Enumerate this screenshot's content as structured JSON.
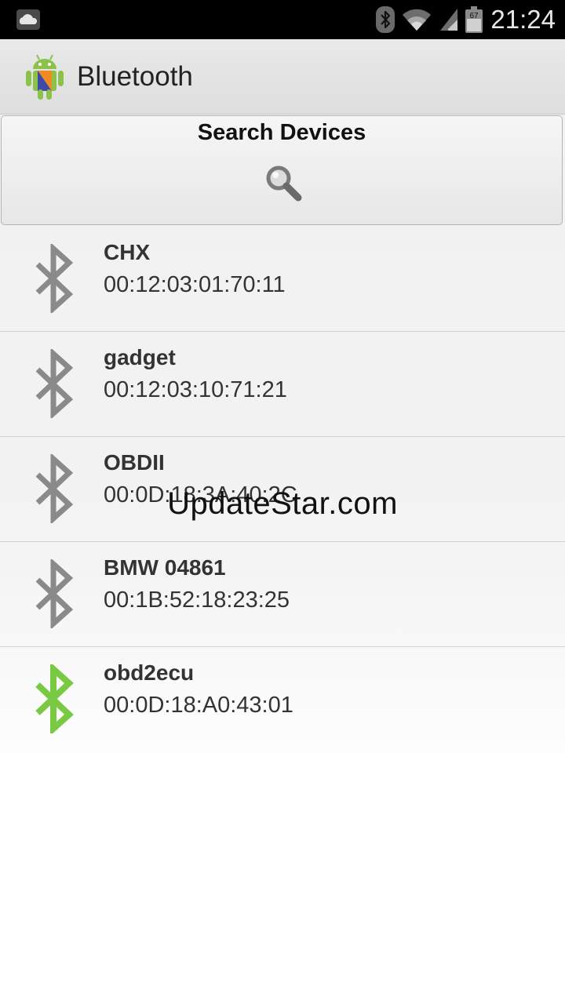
{
  "status_bar": {
    "time": "21:24",
    "battery_level": "67",
    "icons": [
      "cloud-icon",
      "bluetooth-status-icon",
      "wifi-icon",
      "cell-signal-icon",
      "battery-icon"
    ]
  },
  "action_bar": {
    "title": "Bluetooth",
    "app_icon": "android-robot-icon"
  },
  "search": {
    "label": "Search Devices",
    "icon": "magnifier-icon"
  },
  "devices": [
    {
      "name": "CHX",
      "address": "00:12:03:01:70:11",
      "state": "not-connected"
    },
    {
      "name": "gadget",
      "address": "00:12:03:10:71:21",
      "state": "not-connected"
    },
    {
      "name": "OBDII",
      "address": "00:0D:18:3A:40:2C",
      "state": "not-connected"
    },
    {
      "name": "BMW 04861",
      "address": "00:1B:52:18:23:25",
      "state": "not-connected"
    },
    {
      "name": "obd2ecu",
      "address": "00:0D:18:A0:43:01",
      "state": "connected"
    }
  ],
  "watermark": "UpdateStar.com",
  "colors": {
    "status_bar_bg": "#000000",
    "icon_gray": "#8a8a8a",
    "icon_green": "#7ac943",
    "text": "#333333"
  }
}
